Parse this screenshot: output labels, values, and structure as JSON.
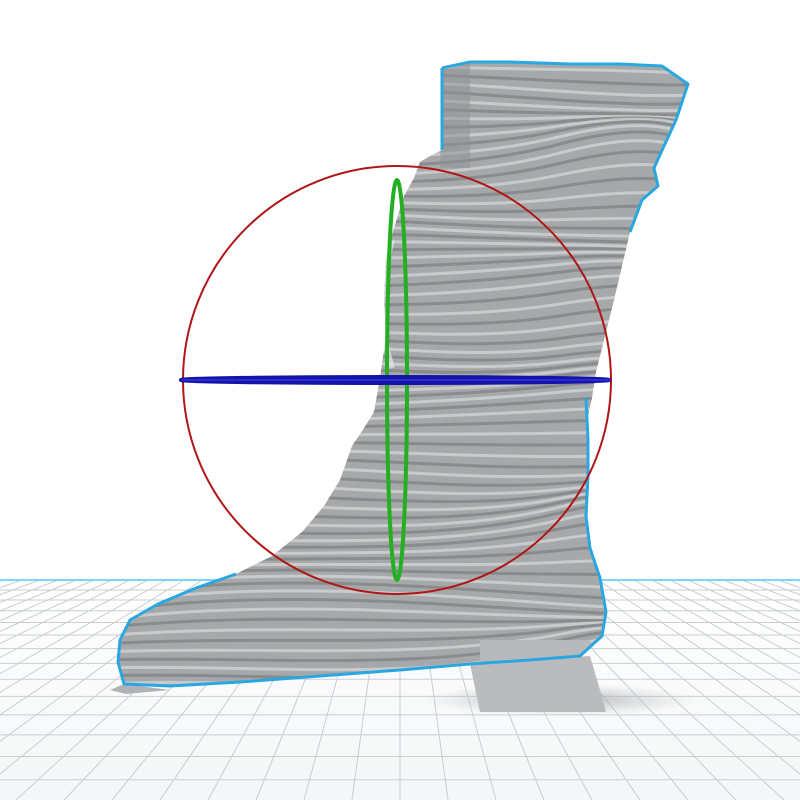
{
  "viewport": {
    "background_color": "#ffffff",
    "build_plate": {
      "grid_line_color": "#c9ced3",
      "edge_color": "#7fd3f5"
    },
    "model": {
      "name": "boot",
      "selected": true,
      "surface_color": "#a6a8aa",
      "layer_band_color": "#7f8183",
      "highlight_color": "#d3d5d6",
      "selection_outline_color": "#2aa7e0",
      "shadow_color": "#b3b5b7"
    },
    "rotate_gizmo": {
      "x_axis_ring_color": "#b01616",
      "y_axis_ring_color": "#22b022",
      "z_axis_ring_color": "#1414a8"
    }
  }
}
